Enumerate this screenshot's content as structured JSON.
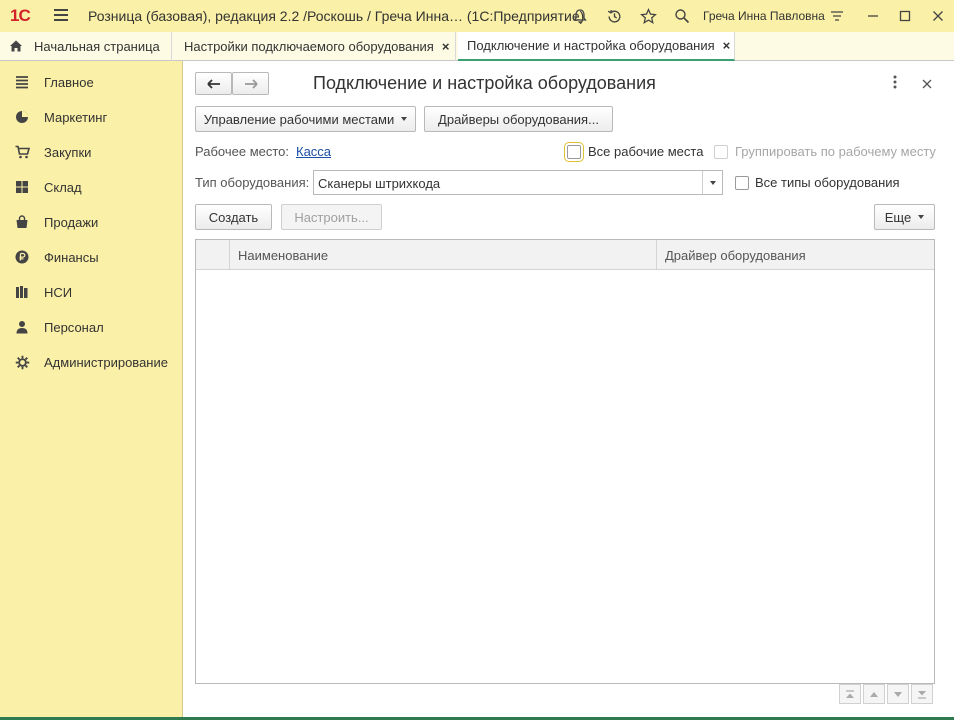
{
  "app": {
    "logo": "1С",
    "title": "Розница (базовая), редакция 2.2 /Роскошь / Греча Инна…  (1С:Предприятие)",
    "user": "Греча Инна Павловна"
  },
  "tabs": [
    {
      "label": "Начальная страница",
      "icon": "home-icon"
    },
    {
      "label": "Настройки подключаемого оборудования",
      "close": "×"
    },
    {
      "label": "Подключение и настройка оборудования",
      "close": "×"
    }
  ],
  "sidebar": {
    "items": [
      {
        "label": "Главное",
        "icon": "list-icon"
      },
      {
        "label": "Маркетинг",
        "icon": "pie-chart-icon"
      },
      {
        "label": "Закупки",
        "icon": "cart-icon"
      },
      {
        "label": "Склад",
        "icon": "warehouse-icon"
      },
      {
        "label": "Продажи",
        "icon": "bag-icon"
      },
      {
        "label": "Финансы",
        "icon": "ruble-icon"
      },
      {
        "label": "НСИ",
        "icon": "book-icon"
      },
      {
        "label": "Персонал",
        "icon": "person-icon"
      },
      {
        "label": "Администрирование",
        "icon": "gear-icon"
      }
    ]
  },
  "form": {
    "title": "Подключение и настройка оборудования",
    "manage_workplaces": "Управление рабочими местами",
    "drivers": "Драйверы оборудования...",
    "workplace_label": "Рабочее место:",
    "workplace_value": "Касса",
    "all_workplaces": "Все рабочие места",
    "group_by_workplace": "Группировать по рабочему месту",
    "equipment_type_label": "Тип оборудования:",
    "equipment_type_value": "Сканеры штрихкода",
    "all_equipment_types": "Все типы оборудования",
    "create": "Создать",
    "configure": "Настроить...",
    "more": "Еще",
    "columns": [
      "Наименование",
      "Драйвер оборудования"
    ]
  },
  "colors": {
    "accent": "#fbf0a7",
    "active_tab_underline": "#3aa070",
    "link": "#1b4fa3"
  }
}
